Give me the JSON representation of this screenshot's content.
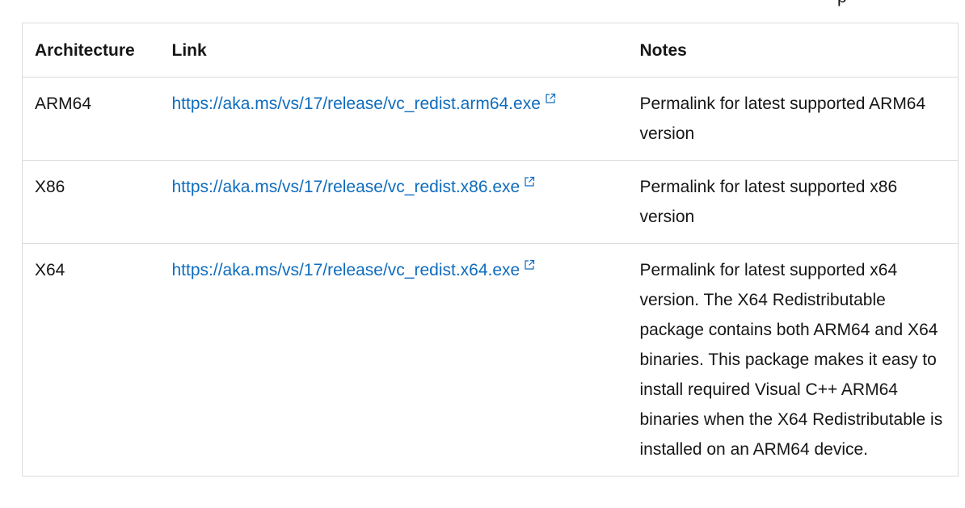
{
  "top_fragment": "p",
  "table": {
    "headers": {
      "architecture": "Architecture",
      "link": "Link",
      "notes": "Notes"
    },
    "rows": [
      {
        "architecture": "ARM64",
        "link": "https://aka.ms/vs/17/release/vc_redist.arm64.exe",
        "notes": "Permalink for latest supported ARM64 version"
      },
      {
        "architecture": "X86",
        "link": "https://aka.ms/vs/17/release/vc_redist.x86.exe",
        "notes": "Permalink for latest supported x86 version"
      },
      {
        "architecture": "X64",
        "link": "https://aka.ms/vs/17/release/vc_redist.x64.exe",
        "notes": "Permalink for latest supported x64 version. The X64 Redistributable package contains both ARM64 and X64 binaries. This package makes it easy to install required Visual C++ ARM64 binaries when the X64 Redistributable is installed on an ARM64 device."
      }
    ]
  },
  "colors": {
    "link": "#0f6cbd",
    "text": "#161616",
    "border": "#dcdcdc"
  },
  "icons": {
    "external_link": "external-link-icon"
  }
}
